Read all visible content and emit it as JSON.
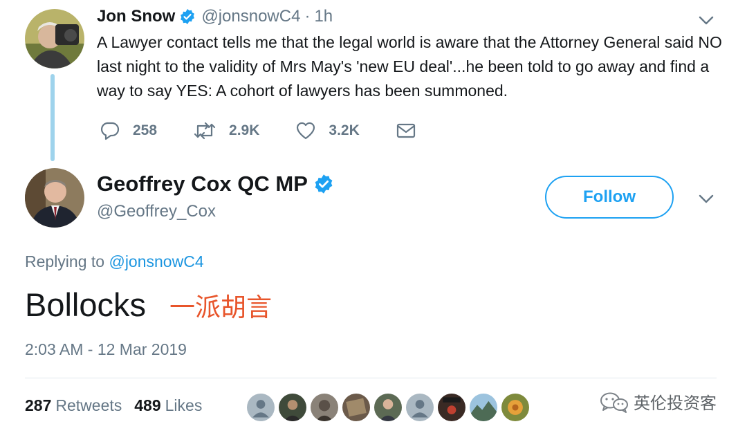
{
  "parent_tweet": {
    "display_name": "Jon Snow",
    "handle": "@jonsnowC4",
    "separator": "·",
    "time_ago": "1h",
    "text": "A Lawyer contact tells me that the legal world is aware that the Attorney General said NO last night to the validity of Mrs May's 'new EU deal'...he been told to go away and find a way to say YES: A cohort of lawyers has been summoned.",
    "replies": "258",
    "retweets": "2.9K",
    "likes": "3.2K"
  },
  "main_tweet": {
    "display_name": "Geoffrey Cox QC MP",
    "handle": "@Geoffrey_Cox",
    "follow_label": "Follow",
    "replying_prefix": "Replying to",
    "replying_to": "@jonsnowC4",
    "text": "Bollocks",
    "annotation": "一派胡言",
    "timestamp": "2:03 AM - 12 Mar 2019",
    "retweet_count": "287",
    "retweet_label": "Retweets",
    "like_count": "489",
    "like_label": "Likes"
  },
  "watermark": {
    "text": "英伦投资客",
    "icon": "wechat-icon"
  },
  "colors": {
    "accent": "#1da1f2",
    "secondary_text": "#657786",
    "annotation": "#e8552b",
    "thread_line": "#9ed3ec"
  }
}
